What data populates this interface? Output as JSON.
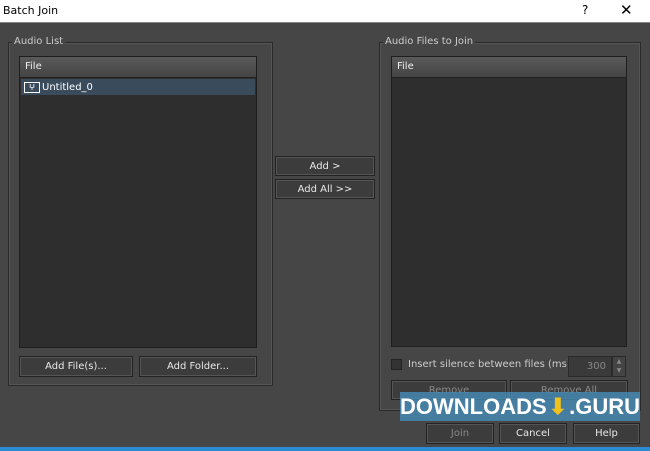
{
  "window": {
    "title": "Batch Join",
    "help": "?",
    "close": "✕"
  },
  "audio_list": {
    "label": "Audio List",
    "column": "File",
    "items": [
      {
        "name": "Untitled_0",
        "icon": "waveform-icon"
      }
    ],
    "add_files": "Add File(s)...",
    "add_folder": "Add Folder..."
  },
  "middle": {
    "add": "Add >",
    "add_all": "Add All >>"
  },
  "join_list": {
    "label": "Audio Files to Join",
    "column": "File",
    "silence_label": "Insert silence between files (ms):",
    "silence_checked": false,
    "silence_value": "300",
    "remove": "Remove",
    "remove_all": "Remove All"
  },
  "footer": {
    "join": "Join",
    "cancel": "Cancel",
    "help": "Help"
  },
  "watermark": {
    "text": "DOWNLOADS",
    "suffix": ".GURU"
  }
}
